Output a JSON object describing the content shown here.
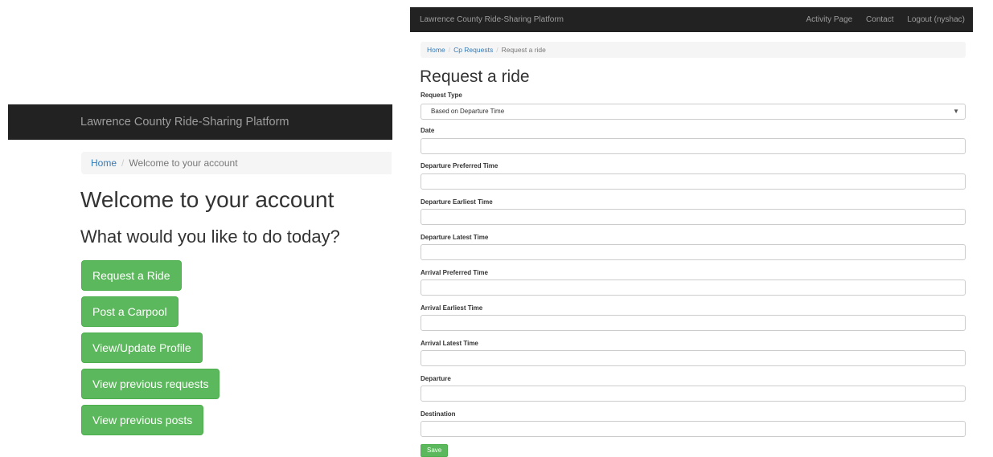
{
  "left": {
    "navbar": {
      "brand": "Lawrence County Ride-Sharing Platform"
    },
    "breadcrumb": {
      "home": "Home",
      "separator": "/",
      "current": "Welcome to your account"
    },
    "title": "Welcome to your account",
    "subtitle": "What would you like to do today?",
    "buttons": [
      {
        "label": "Request a Ride"
      },
      {
        "label": "Post a Carpool"
      },
      {
        "label": "View/Update Profile"
      },
      {
        "label": "View previous requests"
      },
      {
        "label": "View previous posts"
      }
    ]
  },
  "right": {
    "navbar": {
      "brand": "Lawrence County Ride-Sharing Platform",
      "links": [
        "Activity Page",
        "Contact",
        "Logout (nyshac)"
      ]
    },
    "breadcrumb": {
      "home": "Home",
      "separator": "/",
      "middle": "Cp Requests",
      "current": "Request a ride"
    },
    "title": "Request a ride",
    "request_type": {
      "label": "Request Type",
      "value": "Based on Departure Time",
      "caret": "▼"
    },
    "fields": [
      {
        "label": "Date",
        "value": ""
      },
      {
        "label": "Departure Preferred Time",
        "value": ""
      },
      {
        "label": "Departure Earliest Time",
        "value": ""
      },
      {
        "label": "Departure Latest Time",
        "value": ""
      },
      {
        "label": "Arrival Preferred Time",
        "value": ""
      },
      {
        "label": "Arrival Earliest Time",
        "value": ""
      },
      {
        "label": "Arrival Latest Time",
        "value": ""
      },
      {
        "label": "Departure",
        "value": ""
      },
      {
        "label": "Destination",
        "value": ""
      }
    ],
    "save_label": "Save"
  },
  "colors": {
    "navbar": "#222222",
    "success": "#5cb85c",
    "link": "#337ab7"
  }
}
